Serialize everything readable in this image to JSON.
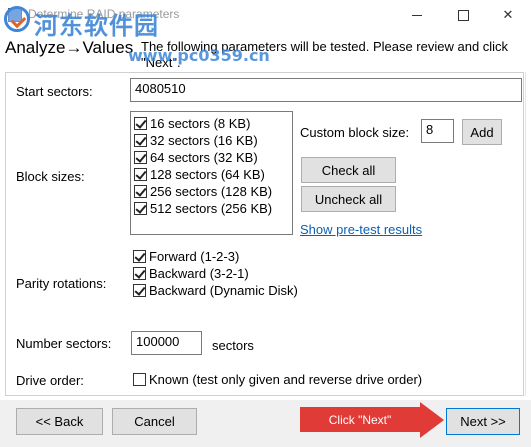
{
  "window": {
    "title": "Determine RAID parameters",
    "icon": "disk-icon",
    "controls": {
      "minimize": "minimize-icon",
      "maximize": "maximize-icon",
      "close": "✕"
    }
  },
  "watermark": {
    "text": "河东软件园",
    "url": "www.pc0359.cn"
  },
  "header": {
    "heading": "Analyze→Values",
    "description": "The following parameters will be tested. Please review and click \"Next\"."
  },
  "start_sectors": {
    "label": "Start sectors:",
    "value": "4080510"
  },
  "block_sizes": {
    "label": "Block sizes:",
    "items": [
      {
        "label": "16 sectors (8 KB)",
        "checked": true
      },
      {
        "label": "32 sectors (16 KB)",
        "checked": true
      },
      {
        "label": "64 sectors (32 KB)",
        "checked": true
      },
      {
        "label": "128 sectors (64 KB)",
        "checked": true
      },
      {
        "label": "256 sectors (128 KB)",
        "checked": true
      },
      {
        "label": "512 sectors (256 KB)",
        "checked": true
      }
    ],
    "custom_label": "Custom block size:",
    "custom_value": "8",
    "add_label": "Add",
    "check_all_label": "Check all",
    "uncheck_all_label": "Uncheck all",
    "pretest_link": "Show pre-test results"
  },
  "parity_rotations": {
    "label": "Parity rotations:",
    "items": [
      {
        "label": "Forward (1-2-3)",
        "checked": true
      },
      {
        "label": "Backward (3-2-1)",
        "checked": true
      },
      {
        "label": "Backward (Dynamic Disk)",
        "checked": true
      }
    ]
  },
  "number_sectors": {
    "label": "Number sectors:",
    "value": "100000",
    "unit": "sectors"
  },
  "drive_order": {
    "label": "Drive order:",
    "option_label": "Known (test only given and reverse drive order)",
    "checked": false
  },
  "footer": {
    "back_label": "<< Back",
    "cancel_label": "Cancel",
    "next_label": "Next >>",
    "annotation": "Click \"Next\""
  },
  "colors": {
    "accent": "#0078d7",
    "link": "#0b5fb5",
    "annotation": "#e03b36",
    "watermark": "#3f86d6"
  }
}
